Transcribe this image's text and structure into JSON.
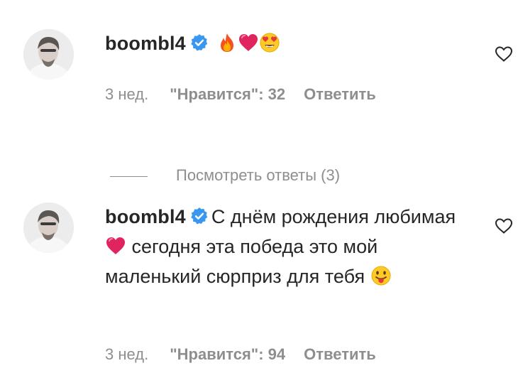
{
  "comments": [
    {
      "username": "boombl4",
      "text_parts": [],
      "meta": {
        "time": "3 нед.",
        "likes": "\"Нравится\": 32",
        "reply": "Ответить"
      },
      "emojis": [
        "fire",
        "heart",
        "heart-eyes"
      ]
    },
    {
      "username": "boombl4",
      "text_part1": "С днём рождения любимая",
      "text_part2": "сегодня эта победа это мой маленький сюрприз для тебя",
      "meta": {
        "time": "3 нед.",
        "likes": "\"Нравится\": 94",
        "reply": "Ответить"
      },
      "emojis": [
        "heart",
        "tongue-face"
      ]
    }
  ],
  "view_replies": "Посмотреть ответы (3)",
  "colors": {
    "text": "#262626",
    "secondary": "#8e8e8e",
    "verified": "#3897f0",
    "heart": "#e0245e"
  }
}
